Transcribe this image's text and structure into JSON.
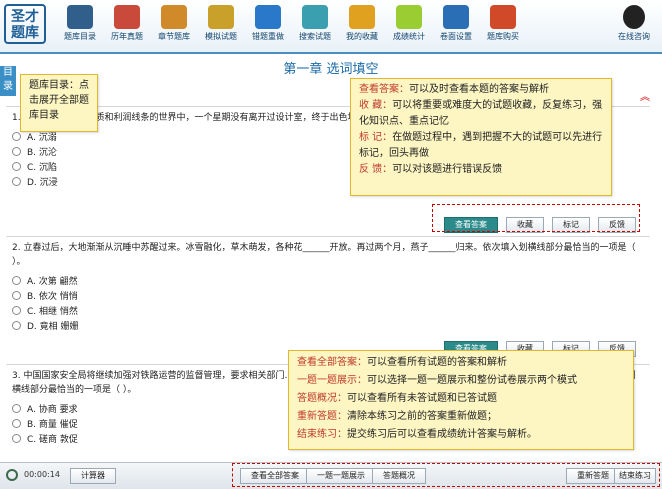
{
  "header": {
    "logo": "圣才题库",
    "nav": [
      {
        "label": "题库目录",
        "icon": "monitor-icon",
        "color": "#2f5f8a"
      },
      {
        "label": "历年真题",
        "icon": "document-icon",
        "color": "#c94a3a"
      },
      {
        "label": "章节题库",
        "icon": "pencil-icon",
        "color": "#d08a2a"
      },
      {
        "label": "模拟试题",
        "icon": "exam-paper-icon",
        "color": "#c9a12a"
      },
      {
        "label": "错题重做",
        "icon": "back-arrow-icon",
        "color": "#2a78c9"
      },
      {
        "label": "搜索试题",
        "icon": "magnifier-icon",
        "color": "#3aa0b0"
      },
      {
        "label": "我的收藏",
        "icon": "star-icon",
        "color": "#e0a020"
      },
      {
        "label": "成绩统计",
        "icon": "chart-icon",
        "color": "#9acd32"
      },
      {
        "label": "卷面设置",
        "icon": "gear-icon",
        "color": "#2a6fb5"
      },
      {
        "label": "题库购买",
        "icon": "cart-icon",
        "color": "#d04a2a"
      }
    ],
    "support_label": "在线咨询",
    "support_icon": "qq-penguin-icon"
  },
  "sidebar_tab": "目录",
  "chapter_title": "第一章  选词填空",
  "collapse_symbol": "︽",
  "questions": [
    {
      "text": "1. 在这个似乎只有物质和利润线条的世界中，一个星期没有离开过设计室，终于出色地完成了……依次填入划横线部分最恰当的一项是（      ）。",
      "options": [
        "A.  沉溺",
        "B.  沉沦",
        "C.  沉陷",
        "D.  沉浸"
      ],
      "buttons": [
        "查看答案",
        "收藏",
        "标记",
        "反馈"
      ]
    },
    {
      "text": "2. 立春过后，大地渐渐从沉睡中苏醒过来。冰雪融化，草木萌发，各种花______开放。再过两个月，燕子______归来。依次填入划横线部分最恰当的一项是（      ）。",
      "options": [
        "A.  次第   翩然",
        "B.  依次   悄悄",
        "C.  相继   悄然",
        "D.  竟相   姗姗"
      ],
      "buttons": [
        "查看答案",
        "收藏",
        "标记",
        "反馈"
      ]
    },
    {
      "text": "3. 中国国家安全局将继续加强对铁路运营的监督管理，要求相关部门……______他们尽快解除对我国高精尖技术的封锁，保证我国铁路运行不……依次填入划横线部分最恰当的一项是（      ）。",
      "options": [
        "A.  协商   要求",
        "B.  商量   催促",
        "C.  磋商   敦促"
      ]
    }
  ],
  "callouts": {
    "catalog": "题库目录：点击展开全部题库目录",
    "question_tools": [
      {
        "label": "查看答案：",
        "desc": "可以及时查看本题的答案与解析"
      },
      {
        "label": "收     藏：",
        "desc": "可以将重要或难度大的试题收藏，反复练习，强化知识点、重点记忆"
      },
      {
        "label": "标     记：",
        "desc": "在做题过程中，遇到把握不大的试题可以先进行标记，回头再做"
      },
      {
        "label": "反     馈：",
        "desc": "可以对该题进行错误反馈"
      }
    ],
    "footer_tools": [
      {
        "label": "查看全部答案：",
        "desc": "可以查看所有试题的答案和解析"
      },
      {
        "label": "一题一题展示：",
        "desc": "可以选择一题一题展示和整份试卷展示两个模式"
      },
      {
        "label": "答题概况：",
        "desc": "可以查看所有未答试题和已答试题"
      },
      {
        "label": "重新答题：",
        "desc": "清除本练习之前的答案重新做题；"
      },
      {
        "label": "结束练习：",
        "desc": "提交练习后可以查看成绩统计答案与解析。"
      }
    ]
  },
  "footer": {
    "timer": "00:00:14",
    "calculator": "计算器",
    "show_all_answers": "查看全部答案",
    "one_by_one": "一题一题展示",
    "answer_overview": "答题概况",
    "restart": "重新答题",
    "finish": "结束练习"
  },
  "colors": {
    "accent": "#2b8a8a",
    "callout_bg": "#fdf6c3",
    "label_red": "#c0392b",
    "title_blue": "#1a6aa8"
  }
}
